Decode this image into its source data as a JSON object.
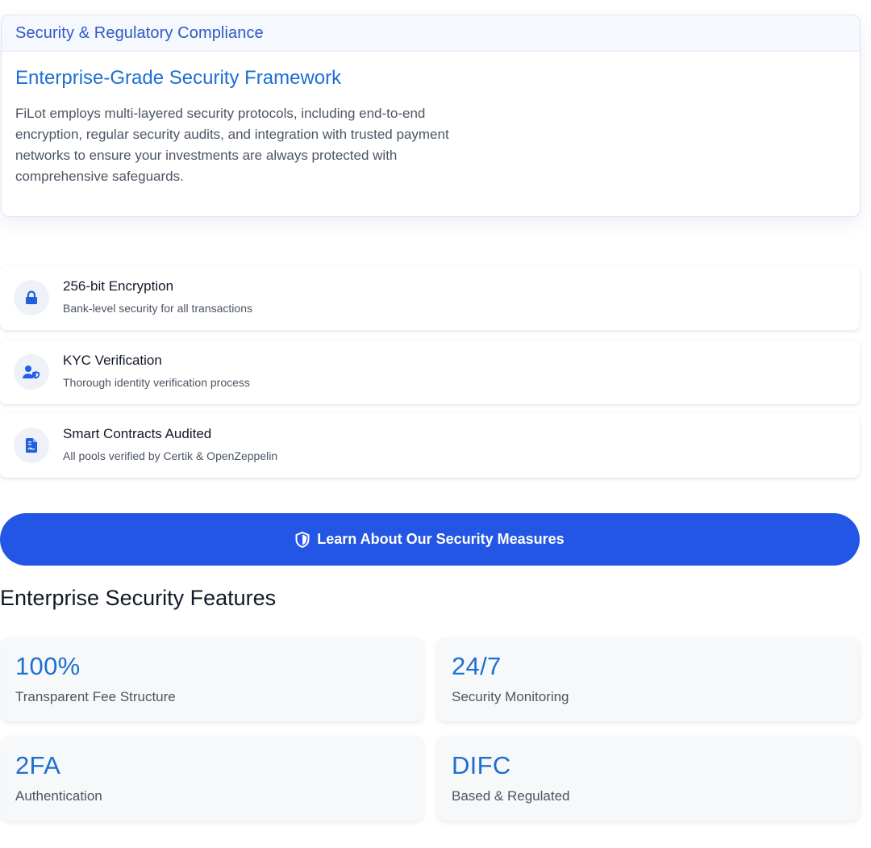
{
  "compliance": {
    "header_title": "Security & Regulatory Compliance",
    "framework_title": "Enterprise-Grade Security Framework",
    "framework_description": "FiLot employs multi-layered security protocols, including end-to-end encryption, regular security audits, and integration with trusted payment networks to ensure your investments are always protected with comprehensive safeguards."
  },
  "features": [
    {
      "icon": "lock-icon",
      "title": "256-bit Encryption",
      "description": "Bank-level security for all transactions"
    },
    {
      "icon": "user-shield-icon",
      "title": "KYC Verification",
      "description": "Thorough identity verification process"
    },
    {
      "icon": "file-contract-icon",
      "title": "Smart Contracts Audited",
      "description": "All pools verified by Certik & OpenZeppelin"
    }
  ],
  "cta": {
    "label": "Learn About Our Security Measures",
    "icon": "shield-icon"
  },
  "security_features": {
    "heading": "Enterprise Security Features",
    "stats": [
      {
        "value": "100%",
        "label": "Transparent Fee Structure"
      },
      {
        "value": "24/7",
        "label": "Security Monitoring"
      },
      {
        "value": "2FA",
        "label": "Authentication"
      },
      {
        "value": "DIFC",
        "label": "Based & Regulated"
      }
    ]
  },
  "colors": {
    "accent": "#2456e5",
    "heading_blue": "#1d6fd1",
    "header_blue": "#2f59c4",
    "icon_blue": "#1f5fe0"
  }
}
